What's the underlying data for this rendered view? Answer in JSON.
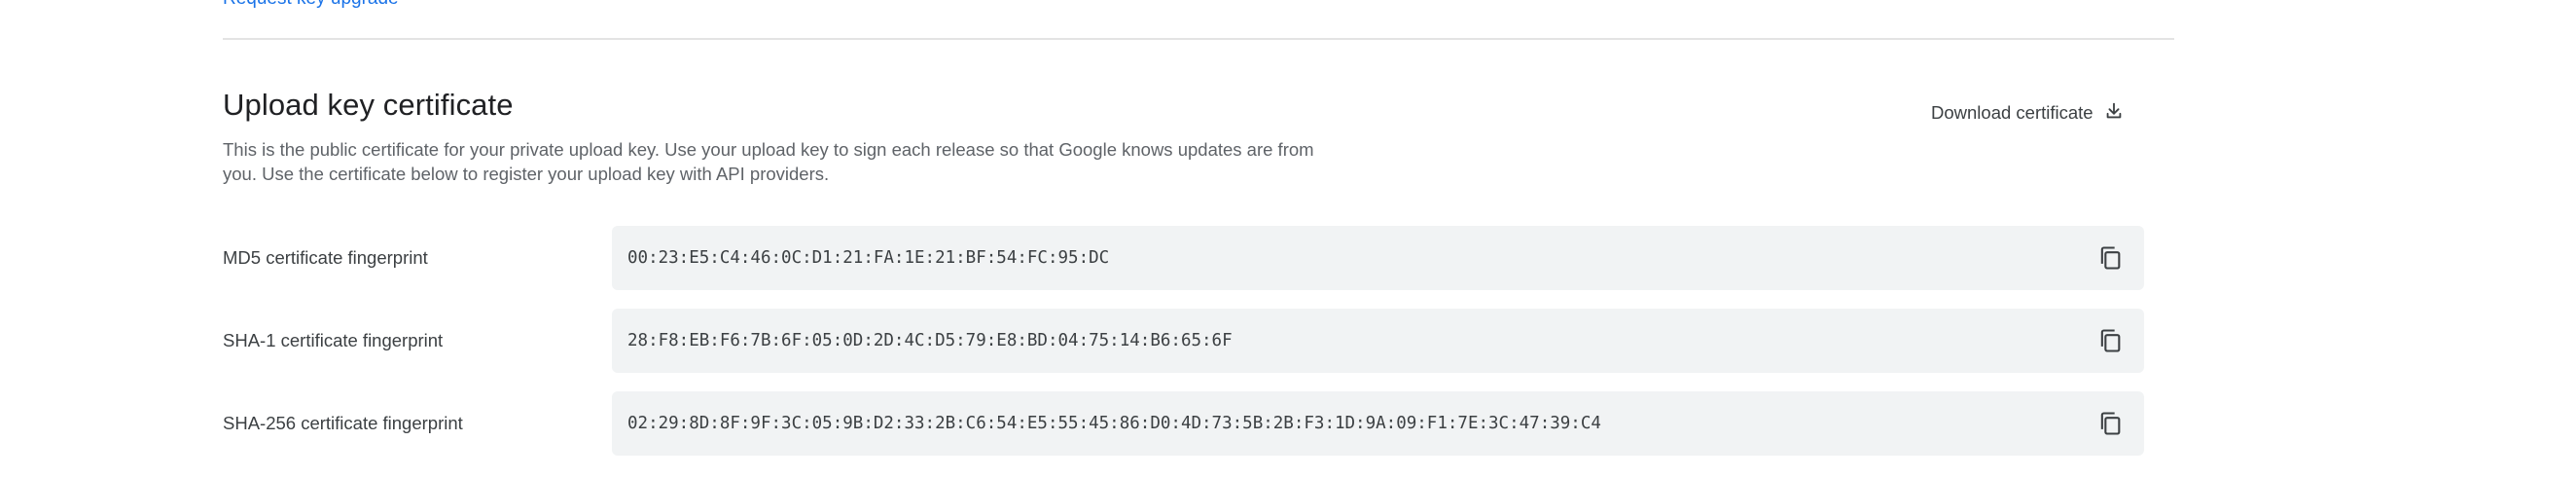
{
  "top_link": {
    "label": "Request key upgrade"
  },
  "section": {
    "title": "Upload key certificate",
    "description": "This is the public certificate for your private upload key. Use your upload key to sign each release so that Google knows updates are from you. Use the certificate below to register your upload key with API providers.",
    "download_label": "Download certificate"
  },
  "fingerprints": [
    {
      "label": "MD5 certificate fingerprint",
      "value": "00:23:E5:C4:46:0C:D1:21:FA:1E:21:BF:54:FC:95:DC"
    },
    {
      "label": "SHA-1 certificate fingerprint",
      "value": "28:F8:EB:F6:7B:6F:05:0D:2D:4C:D5:79:E8:BD:04:75:14:B6:65:6F"
    },
    {
      "label": "SHA-256 certificate fingerprint",
      "value": "02:29:8D:8F:9F:3C:05:9B:D2:33:2B:C6:54:E5:55:45:86:D0:4D:73:5B:2B:F3:1D:9A:09:F1:7E:3C:47:39:C4"
    }
  ],
  "icons": {
    "download": "download-icon",
    "copy": "copy-icon"
  },
  "colors": {
    "link": "#1a73e8",
    "fingerprint_bg": "#f1f3f4",
    "divider": "#e3e3e3"
  }
}
